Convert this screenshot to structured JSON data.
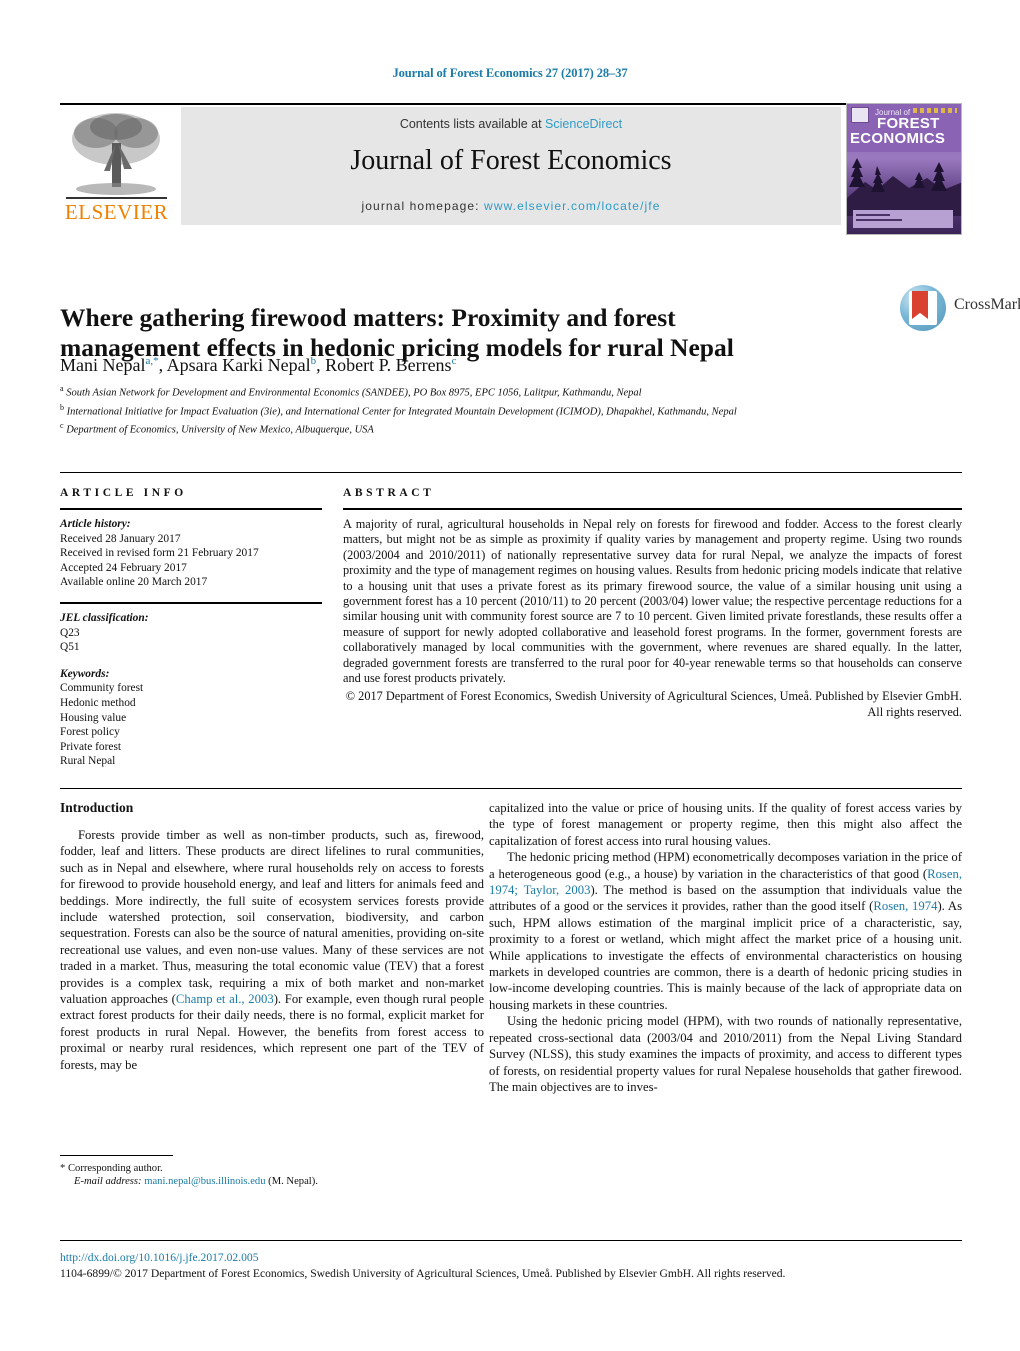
{
  "running_head": "Journal of Forest Economics 27 (2017) 28–37",
  "masthead": {
    "contents_prefix": "Contents lists available at ",
    "sciencedirect": "ScienceDirect",
    "journal_title": "Journal of Forest Economics",
    "homepage_prefix": "journal homepage: ",
    "homepage_url": "www.elsevier.com/locate/jfe",
    "publisher_logo_text": "ELSEVIER",
    "cover": {
      "journal_of": "Journal of",
      "forest": "FOREST",
      "economics": "ECONOMICS"
    },
    "link_color": "#2e9cc8"
  },
  "article": {
    "title": "Where gathering firewood matters: Proximity and forest management effects in hedonic pricing models for rural Nepal",
    "authors_html": "Mani Nepal<sup>a,*</sup>, Apsara Karki Nepal<sup>b</sup>, Robert P. Berrens<sup>c</sup>",
    "affiliations": [
      {
        "marker": "a",
        "text": "South Asian Network for Development and Environmental Economics (SANDEE), PO Box 8975, EPC 1056, Lalitpur, Kathmandu, Nepal"
      },
      {
        "marker": "b",
        "text": "International Initiative for Impact Evaluation (3ie), and International Center for Integrated Mountain Development (ICIMOD), Dhapakhel, Kathmandu, Nepal"
      },
      {
        "marker": "c",
        "text": "Department of Economics, University of New Mexico, Albuquerque, USA"
      }
    ],
    "crossmark_label": "CrossMark"
  },
  "article_info": {
    "heading": "ARTICLE INFO",
    "history_label": "Article history:",
    "history": [
      "Received 28 January 2017",
      "Received in revised form 21 February 2017",
      "Accepted 24 February 2017",
      "Available online 20 March 2017"
    ],
    "jel_label": "JEL classification:",
    "jel": [
      "Q23",
      "Q51"
    ],
    "keywords_label": "Keywords:",
    "keywords": [
      "Community forest",
      "Hedonic method",
      "Housing value",
      "Forest policy",
      "Private forest",
      "Rural Nepal"
    ]
  },
  "abstract": {
    "heading": "ABSTRACT",
    "body": "A majority of rural, agricultural households in Nepal rely on forests for firewood and fodder. Access to the forest clearly matters, but might not be as simple as proximity if quality varies by management and property regime. Using two rounds (2003/2004 and 2010/2011) of nationally representative survey data for rural Nepal, we analyze the impacts of forest proximity and the type of management regimes on housing values. Results from hedonic pricing models indicate that relative to a housing unit that uses a private forest as its primary firewood source, the value of a similar housing unit using a government forest has a 10 percent (2010/11) to 20 percent (2003/04) lower value; the respective percentage reductions for a similar housing unit with community forest source are 7 to 10 percent. Given limited private forestlands, these results offer a measure of support for newly adopted collaborative and leasehold forest programs. In the former, government forests are collaboratively managed by local communities with the government, where revenues are shared equally. In the latter, degraded government forests are transferred to the rural poor for 40-year renewable terms so that households can conserve and use forest products privately.",
    "copyright": "© 2017 Department of Forest Economics, Swedish University of Agricultural Sciences, Umeå. Published by Elsevier GmbH. All rights reserved."
  },
  "body": {
    "section_heading": "Introduction",
    "left_paragraphs": [
      "Forests provide timber as well as non-timber products, such as, firewood, fodder, leaf and litters. These products are direct lifelines to rural communities, such as in Nepal and elsewhere, where rural households rely on access to forests for firewood to provide household energy, and leaf and litters for animals feed and beddings. More indirectly, the full suite of ecosystem services forests provide include watershed protection, soil conservation, biodiversity, and carbon sequestration. Forests can also be the source of natural amenities, providing on-site recreational use values, and even non-use values. Many of these services are not traded in a market. Thus, measuring the total economic value (TEV) that a forest provides is a complex task, requiring a mix of both market and non-market valuation approaches (@REF:Champ et al., 2003@). For example, even though rural people extract forest products for their daily needs, there is no formal, explicit market for forest products in rural Nepal. However, the benefits from forest access to proximal or nearby rural residences, which represent one part of the TEV of forests, may be"
    ],
    "right_paragraphs": [
      "capitalized into the value or price of housing units. If the quality of forest access varies by the type of forest management or property regime, then this might also affect the capitalization of forest access into rural housing values.",
      "The hedonic pricing method (HPM) econometrically decomposes variation in the price of a heterogeneous good (e.g., a house) by variation in the characteristics of that good (@REF:Rosen, 1974; Taylor, 2003@). The method is based on the assumption that individuals value the attributes of a good or the services it provides, rather than the good itself (@REF:Rosen, 1974@). As such, HPM allows estimation of the marginal implicit price of a characteristic, say, proximity to a forest or wetland, which might affect the market price of a housing unit. While applications to investigate the effects of environmental characteristics on housing markets in developed countries are common, there is a dearth of hedonic pricing studies in low-income developing countries. This is mainly because of the lack of appropriate data on housing markets in these countries.",
      "Using the hedonic pricing model (HPM), with two rounds of nationally representative, repeated cross-sectional data (2003/04 and 2010/2011) from the Nepal Living Standard Survey (NLSS), this study examines the impacts of proximity, and access to different types of forests, on residential property values for rural Nepalese households that gather firewood. The main objectives are to inves-"
    ]
  },
  "footnote": {
    "corresponding_marker": "*",
    "corresponding_label": "Corresponding author.",
    "email_label": "E-mail address:",
    "email": "mani.nepal@bus.illinois.edu",
    "email_suffix": "(M. Nepal)."
  },
  "footer": {
    "doi": "http://dx.doi.org/10.1016/j.jfe.2017.02.005",
    "copyright_line": "1104-6899/© 2017 Department of Forest Economics, Swedish University of Agricultural Sciences, Umeå. Published by Elsevier GmbH. All rights reserved."
  }
}
